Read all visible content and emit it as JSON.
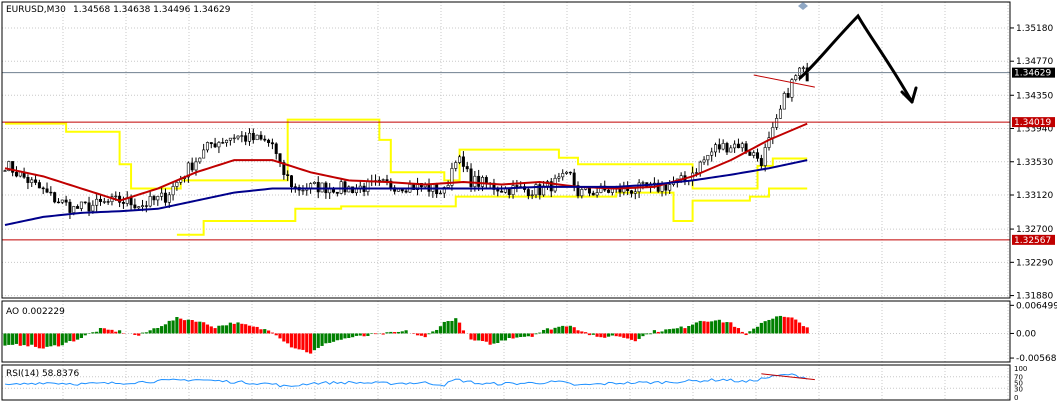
{
  "header": {
    "symbol": "EURUSD,M30",
    "ohlc": "1.34568 1.34638 1.34496 1.34629"
  },
  "panes": {
    "ao_label": "AO 0.002229",
    "rsi_label": "RSI(14) 58.8376"
  },
  "colors": {
    "background": "#ffffff",
    "grid": "#c8c8c8",
    "candle": "#000000",
    "sma_red": "#c00000",
    "sma_blue": "#00008b",
    "channel_yellow": "#ffff00",
    "level_line": "#c00000",
    "price_line": "#708090",
    "ao_up": "#008000",
    "ao_down": "#ff0000",
    "rsi_line": "#1e90ff",
    "annotation": "#000000"
  },
  "chart_data": [
    {
      "type": "candlestick",
      "pane": "price",
      "ylim": [
        1.3185,
        1.355
      ],
      "ticks": [
        "1.35180",
        "1.34770",
        "1.34350",
        "1.33940",
        "1.33530",
        "1.33120",
        "1.32700",
        "1.32290",
        "1.31880"
      ],
      "tick_values": [
        1.3518,
        1.3477,
        1.3435,
        1.3394,
        1.3353,
        1.3312,
        1.327,
        1.3229,
        1.3188
      ],
      "current_price": "1.34629",
      "current_price_value": 1.34629,
      "levels": [
        {
          "label": "1.34019",
          "value": 1.34019
        },
        {
          "label": "1.32567",
          "value": 1.32567
        }
      ],
      "close_anchors": [
        [
          0,
          1.335
        ],
        [
          6,
          1.333
        ],
        [
          12,
          1.331
        ],
        [
          18,
          1.3295
        ],
        [
          24,
          1.33
        ],
        [
          30,
          1.3305
        ],
        [
          36,
          1.33
        ],
        [
          42,
          1.331
        ],
        [
          48,
          1.3345
        ],
        [
          54,
          1.3375
        ],
        [
          60,
          1.3385
        ],
        [
          66,
          1.338
        ],
        [
          70,
          1.3375
        ],
        [
          72,
          1.3345
        ],
        [
          76,
          1.332
        ],
        [
          82,
          1.3322
        ],
        [
          90,
          1.332
        ],
        [
          100,
          1.3325
        ],
        [
          110,
          1.3322
        ],
        [
          115,
          1.3315
        ],
        [
          118,
          1.336
        ],
        [
          122,
          1.333
        ],
        [
          130,
          1.332
        ],
        [
          140,
          1.3318
        ],
        [
          148,
          1.3335
        ],
        [
          150,
          1.3315
        ],
        [
          160,
          1.3318
        ],
        [
          170,
          1.332
        ],
        [
          178,
          1.333
        ],
        [
          180,
          1.334
        ],
        [
          186,
          1.337
        ],
        [
          192,
          1.3375
        ],
        [
          198,
          1.3355
        ],
        [
          202,
          1.34
        ],
        [
          204,
          1.343
        ],
        [
          206,
          1.345
        ],
        [
          208,
          1.3465
        ],
        [
          210,
          1.346
        ]
      ],
      "sma_red": [
        [
          0,
          1.3345
        ],
        [
          10,
          1.3335
        ],
        [
          20,
          1.332
        ],
        [
          30,
          1.3305
        ],
        [
          40,
          1.332
        ],
        [
          50,
          1.334
        ],
        [
          60,
          1.3355
        ],
        [
          70,
          1.3355
        ],
        [
          80,
          1.334
        ],
        [
          90,
          1.333
        ],
        [
          100,
          1.3328
        ],
        [
          110,
          1.3325
        ],
        [
          120,
          1.3328
        ],
        [
          130,
          1.3325
        ],
        [
          140,
          1.3328
        ],
        [
          150,
          1.3322
        ],
        [
          160,
          1.332
        ],
        [
          170,
          1.3322
        ],
        [
          180,
          1.3335
        ],
        [
          190,
          1.3355
        ],
        [
          200,
          1.338
        ],
        [
          210,
          1.34
        ]
      ],
      "sma_blue": [
        [
          0,
          1.3275
        ],
        [
          10,
          1.3285
        ],
        [
          20,
          1.329
        ],
        [
          30,
          1.3292
        ],
        [
          40,
          1.3295
        ],
        [
          50,
          1.3305
        ],
        [
          60,
          1.3315
        ],
        [
          70,
          1.332
        ],
        [
          80,
          1.332
        ],
        [
          90,
          1.332
        ],
        [
          100,
          1.332
        ],
        [
          110,
          1.332
        ],
        [
          120,
          1.332
        ],
        [
          130,
          1.332
        ],
        [
          140,
          1.3322
        ],
        [
          150,
          1.3322
        ],
        [
          160,
          1.3322
        ],
        [
          170,
          1.3325
        ],
        [
          180,
          1.333
        ],
        [
          190,
          1.3337
        ],
        [
          200,
          1.3345
        ],
        [
          210,
          1.3355
        ]
      ],
      "channel_upper": [
        [
          0,
          1.34
        ],
        [
          16,
          1.34
        ],
        [
          16,
          1.339
        ],
        [
          30,
          1.339
        ],
        [
          30,
          1.335
        ],
        [
          33,
          1.335
        ],
        [
          33,
          1.332
        ],
        [
          46,
          1.332
        ],
        [
          46,
          1.333
        ],
        [
          74,
          1.333
        ],
        [
          74,
          1.3405
        ],
        [
          98,
          1.3405
        ],
        [
          98,
          1.338
        ],
        [
          101,
          1.338
        ],
        [
          101,
          1.334
        ],
        [
          115,
          1.334
        ],
        [
          115,
          1.333
        ],
        [
          119,
          1.333
        ],
        [
          119,
          1.3368
        ],
        [
          145,
          1.3368
        ],
        [
          145,
          1.3358
        ],
        [
          150,
          1.3358
        ],
        [
          150,
          1.335
        ],
        [
          180,
          1.335
        ],
        [
          180,
          1.332
        ],
        [
          197,
          1.332
        ],
        [
          197,
          1.3348
        ],
        [
          201,
          1.3348
        ],
        [
          201,
          1.3357
        ],
        [
          210,
          1.3357
        ]
      ],
      "channel_lower": [
        [
          45,
          1.3263
        ],
        [
          52,
          1.3263
        ],
        [
          52,
          1.328
        ],
        [
          76,
          1.328
        ],
        [
          76,
          1.3295
        ],
        [
          88,
          1.3295
        ],
        [
          88,
          1.3298
        ],
        [
          118,
          1.3298
        ],
        [
          118,
          1.331
        ],
        [
          160,
          1.331
        ],
        [
          160,
          1.3315
        ],
        [
          175,
          1.3315
        ],
        [
          175,
          1.328
        ],
        [
          180,
          1.328
        ],
        [
          180,
          1.3305
        ],
        [
          195,
          1.3305
        ],
        [
          195,
          1.331
        ],
        [
          200,
          1.331
        ],
        [
          200,
          1.332
        ],
        [
          210,
          1.332
        ]
      ],
      "trendline": [
        [
          196,
          1.346
        ],
        [
          212,
          1.3445
        ]
      ]
    },
    {
      "type": "histogram",
      "pane": "AO",
      "name": "AO",
      "ticks": [
        "0.006499",
        "0.00",
        "-0.005688"
      ],
      "tick_values": [
        0.006499,
        0.0,
        -0.005688
      ],
      "ylim": [
        -0.0066,
        0.0075
      ],
      "anchors": [
        [
          0,
          -0.003
        ],
        [
          5,
          -0.0025
        ],
        [
          10,
          -0.0035
        ],
        [
          15,
          -0.0025
        ],
        [
          20,
          -0.001
        ],
        [
          25,
          0.001
        ],
        [
          30,
          0.0005
        ],
        [
          35,
          -0.0005
        ],
        [
          40,
          0.0015
        ],
        [
          45,
          0.0035
        ],
        [
          50,
          0.003
        ],
        [
          55,
          0.0015
        ],
        [
          60,
          0.0025
        ],
        [
          65,
          0.0015
        ],
        [
          70,
          0.0005
        ],
        [
          75,
          -0.003
        ],
        [
          80,
          -0.0045
        ],
        [
          85,
          -0.002
        ],
        [
          90,
          -0.001
        ],
        [
          95,
          -0.0005
        ],
        [
          100,
          0.0
        ],
        [
          105,
          0.0005
        ],
        [
          110,
          -0.001
        ],
        [
          115,
          0.0025
        ],
        [
          118,
          0.0035
        ],
        [
          122,
          -0.0015
        ],
        [
          128,
          -0.0025
        ],
        [
          132,
          -0.001
        ],
        [
          138,
          -0.0005
        ],
        [
          142,
          0.001
        ],
        [
          148,
          0.002
        ],
        [
          150,
          0.001
        ],
        [
          155,
          -0.001
        ],
        [
          160,
          -0.0005
        ],
        [
          165,
          -0.0015
        ],
        [
          170,
          0.0005
        ],
        [
          175,
          0.001
        ],
        [
          178,
          0.0015
        ],
        [
          182,
          0.003
        ],
        [
          186,
          0.003
        ],
        [
          190,
          0.0025
        ],
        [
          194,
          -0.0005
        ],
        [
          198,
          0.0025
        ],
        [
          202,
          0.004
        ],
        [
          206,
          0.0035
        ],
        [
          210,
          0.0015
        ]
      ]
    },
    {
      "type": "line",
      "pane": "RSI",
      "name": "RSI(14)",
      "ticks": [
        "100",
        "70",
        "50",
        "30",
        "0"
      ],
      "tick_values": [
        100,
        70,
        50,
        30,
        0
      ],
      "ylim": [
        0,
        100
      ],
      "anchors": [
        [
          0,
          40
        ],
        [
          10,
          50
        ],
        [
          20,
          45
        ],
        [
          30,
          48
        ],
        [
          40,
          55
        ],
        [
          50,
          60
        ],
        [
          60,
          52
        ],
        [
          70,
          45
        ],
        [
          74,
          35
        ],
        [
          80,
          48
        ],
        [
          90,
          50
        ],
        [
          100,
          47
        ],
        [
          110,
          49
        ],
        [
          115,
          42
        ],
        [
          118,
          60
        ],
        [
          125,
          45
        ],
        [
          135,
          47
        ],
        [
          145,
          52
        ],
        [
          150,
          40
        ],
        [
          160,
          48
        ],
        [
          170,
          50
        ],
        [
          180,
          55
        ],
        [
          188,
          60
        ],
        [
          194,
          52
        ],
        [
          200,
          68
        ],
        [
          205,
          78
        ],
        [
          210,
          66
        ]
      ],
      "trendline": [
        [
          198,
          80
        ],
        [
          212,
          60
        ]
      ]
    }
  ]
}
